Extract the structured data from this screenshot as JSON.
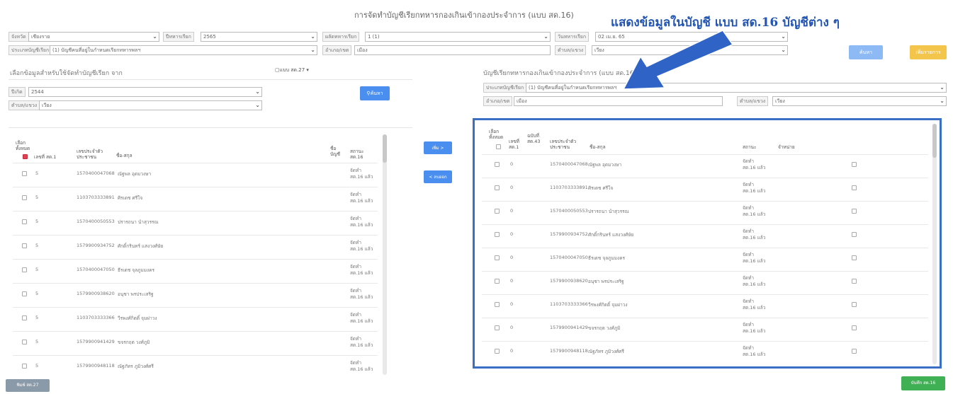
{
  "title": "การจัดทำบัญชีเรียกทหารกองเกินเข้ากองประจำการ (แบบ สด.16)",
  "annotation": "แสดงข้อมูลในบัญชี แบบ สด.16 บัญชีต่าง ๆ",
  "filters": {
    "province_label": "จังหวัด",
    "province_value": "เชียงราย",
    "year_label": "ปีทหารเรียก",
    "year_value": "2565",
    "round_label": "ผลัดทหารเรียก",
    "round_value": "1 (1)",
    "date_label": "วันทหารเรียก",
    "date_value": "02 เม.ย. 65",
    "account_type_label": "ประเภทบัญชีเรียก",
    "account_type_value": "(1) บัญชีคนที่อยู่ในกำหนดเรียกทหารพลฯ",
    "district_label": "อำเภอ/เขต",
    "district_value": "เมือง",
    "subdistrict_label": "ตำบล/แขวง",
    "subdistrict_value": "เวียง",
    "search_button": "ค้นหา",
    "add_button": "เพิ่มรายการ"
  },
  "left": {
    "heading": "เลือกข้อมูลสำหรับใช้จัดทำบัญชีเรียก จาก",
    "source_button": "แบบ สด.27",
    "birth_year_label": "ปีเกิด",
    "birth_year_value": "2544",
    "subdistrict_label": "ตำบล/แขวง",
    "subdistrict_value": "เวียง",
    "search_button": "ค้นหา",
    "columns": [
      "เลือก ทั้งหมด",
      "เลขที่ สด.1",
      "เลขประจำตัว ประชาชน",
      "ชื่อ-สกุล",
      "ชื่อ บัญชี",
      "สถานะ สด.16"
    ],
    "rows": [
      {
        "no": "5",
        "id": "1570400047068",
        "name": "ณัฐพล อุดมวงษา",
        "status": "จัดทำ สด.16 แล้ว"
      },
      {
        "no": "5",
        "id": "1103703333891",
        "name": "ศิรเดช ศรีใจ",
        "status": "จัดทำ สด.16 แล้ว"
      },
      {
        "no": "5",
        "id": "1570400050553",
        "name": "ปรารถนา นำสุวรรณ",
        "status": "จัดทำ สด.16 แล้ว"
      },
      {
        "no": "5",
        "id": "1579900934752",
        "name": "ศักดิ์กรินทร์ แสงวงศ์ษัย",
        "status": "จัดทำ สด.16 แล้ว"
      },
      {
        "no": "5",
        "id": "1570400047050",
        "name": "ธีรเดช จุลภูมมงคร",
        "status": "จัดทำ สด.16 แล้ว"
      },
      {
        "no": "5",
        "id": "1579900938620",
        "name": "อนุชา พรประเสริฐ",
        "status": "จัดทำ สด.16 แล้ว"
      },
      {
        "no": "5",
        "id": "1103703333366",
        "name": "วีรพงศ์กิตติ์ จุมผ่าวง",
        "status": "จัดทำ สด.16 แล้ว"
      },
      {
        "no": "5",
        "id": "1579900941429",
        "name": "ขจรกฤต วงศ์ภูมิ",
        "status": "จัดทำ สด.16 แล้ว"
      },
      {
        "no": "5",
        "id": "1579900948118",
        "name": "ณัฐภัทร ภูมิวงศ์ศรี",
        "status": "จัดทำ สด.16 แล้ว"
      }
    ],
    "footer_button": "พิมพ์ สด.27"
  },
  "middle": {
    "move_right": "เพิ่ม >",
    "move_left": "< ลบออก"
  },
  "right": {
    "heading": "บัญชีเรียกทหารกองเกินเข้ากองประจำการ (แบบ สด.16)",
    "account_type_label": "ประเภทบัญชีเรียก",
    "account_type_value": "(1) บัญชีคนที่อยู่ในกำหนดเรียกทหารพลฯ",
    "district_label": "อำเภอ/เขต",
    "district_value": "เมือง",
    "subdistrict_label": "ตำบล/แขวง",
    "subdistrict_value": "เวียง",
    "columns": [
      "เลือก ทั้งหมด",
      "เลขที่ สด.1",
      "ฉบับที่ สด.43",
      "เลขประจำตัว ประชาชน",
      "ชื่อ-สกุล",
      "สถานะ",
      "จำหน่าย"
    ],
    "rows": [
      {
        "no": "0",
        "id": "1570400047068",
        "name": "ณัฐพล อุดมวงษา",
        "status": "จัดทำ สด.16 แล้ว"
      },
      {
        "no": "0",
        "id": "1103703333891",
        "name": "ศิรเดช ศรีใจ",
        "status": "จัดทำ สด.16 แล้ว"
      },
      {
        "no": "0",
        "id": "1570400050553",
        "name": "ปรารถนา นำสุวรรณ",
        "status": "จัดทำ สด.16 แล้ว"
      },
      {
        "no": "0",
        "id": "1579900934752",
        "name": "ศักดิ์กรินทร์ แสงวงศ์ษัย",
        "status": "จัดทำ สด.16 แล้ว"
      },
      {
        "no": "0",
        "id": "1570400047050",
        "name": "ธีรเดช จุลภูมมงคร",
        "status": "จัดทำ สด.16 แล้ว"
      },
      {
        "no": "0",
        "id": "1579900938620",
        "name": "อนุชา พรประเสริฐ",
        "status": "จัดทำ สด.16 แล้ว"
      },
      {
        "no": "0",
        "id": "1103703333366",
        "name": "วีรพงศ์กิตติ์ จุมผ่าวง",
        "status": "จัดทำ สด.16 แล้ว"
      },
      {
        "no": "0",
        "id": "1579900941429",
        "name": "ขจรกฤต วงศ์ภูมิ",
        "status": "จัดทำ สด.16 แล้ว"
      },
      {
        "no": "0",
        "id": "1579900948118",
        "name": "ณัฐภัทร ภูมิวงศ์ศรี",
        "status": "จัดทำ สด.16 แล้ว"
      }
    ],
    "footer_button": "บันทึก สด.16"
  },
  "colors": {
    "accent_blue": "#3b6fc6",
    "checkbox_red": "#e04050",
    "save_green": "#3fb154"
  }
}
